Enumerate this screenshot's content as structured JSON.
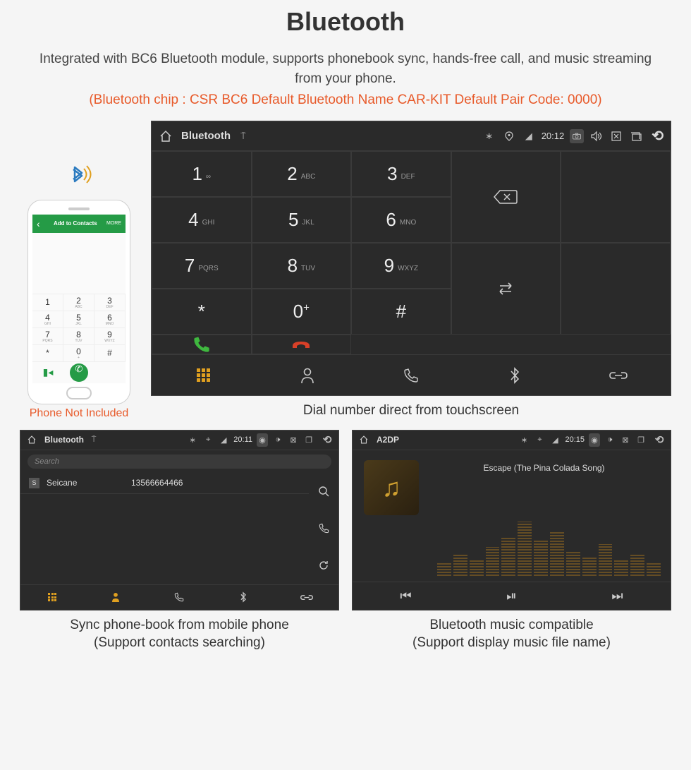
{
  "header": {
    "title": "Bluetooth",
    "description": "Integrated with BC6 Bluetooth module, supports phonebook sync, hands-free call, and music streaming from your phone.",
    "specs": "(Bluetooth chip : CSR BC6    Default Bluetooth Name CAR-KIT    Default Pair Code: 0000)"
  },
  "phone": {
    "add_label": "Add to Contacts",
    "more_label": "MORE",
    "not_included": "Phone Not Included",
    "pad": [
      {
        "n": "1",
        "s": ""
      },
      {
        "n": "2",
        "s": "ABC"
      },
      {
        "n": "3",
        "s": "DEF"
      },
      {
        "n": "4",
        "s": "GHI"
      },
      {
        "n": "5",
        "s": "JKL"
      },
      {
        "n": "6",
        "s": "MNO"
      },
      {
        "n": "7",
        "s": "PQRS"
      },
      {
        "n": "8",
        "s": "TUV"
      },
      {
        "n": "9",
        "s": "WXYZ"
      },
      {
        "n": "*",
        "s": ""
      },
      {
        "n": "0",
        "s": "+"
      },
      {
        "n": "#",
        "s": ""
      }
    ]
  },
  "dialer": {
    "status_title": "Bluetooth",
    "time": "20:12",
    "caption": "Dial number direct from touchscreen",
    "keys": [
      {
        "n": "1",
        "l": "∞"
      },
      {
        "n": "2",
        "l": "ABC"
      },
      {
        "n": "3",
        "l": "DEF"
      },
      {
        "n": "4",
        "l": "GHI"
      },
      {
        "n": "5",
        "l": "JKL"
      },
      {
        "n": "6",
        "l": "MNO"
      },
      {
        "n": "7",
        "l": "PQRS"
      },
      {
        "n": "8",
        "l": "TUV"
      },
      {
        "n": "9",
        "l": "WXYZ"
      },
      {
        "n": "*",
        "l": ""
      },
      {
        "n": "0",
        "l": "+"
      },
      {
        "n": "#",
        "l": ""
      }
    ]
  },
  "phonebook": {
    "status_title": "Bluetooth",
    "time": "20:11",
    "search_placeholder": "Search",
    "contact_badge": "S",
    "contact_name": "Seicane",
    "contact_number": "13566664466",
    "caption_line1": "Sync phone-book from mobile phone",
    "caption_line2": "(Support contacts searching)"
  },
  "music": {
    "status_title": "A2DP",
    "time": "20:15",
    "track": "Escape (The Pina Colada Song)",
    "caption_line1": "Bluetooth music compatible",
    "caption_line2": "(Support display music file name)"
  }
}
